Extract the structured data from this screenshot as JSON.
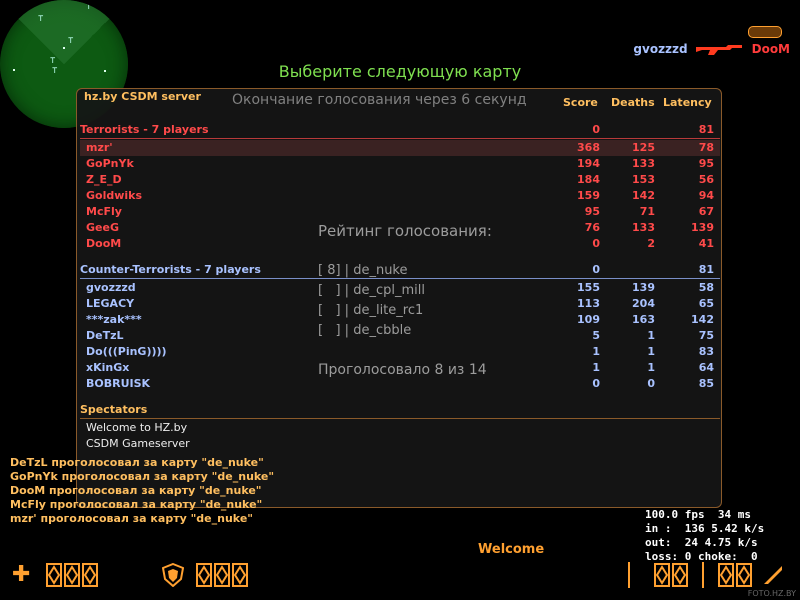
{
  "killfeed": {
    "killer": "gvozzzd",
    "weapon_icon": "rifle-icon",
    "victim": "DooM"
  },
  "vote_title": "Выберите следующую карту",
  "server_name": "hz.by CSDM server",
  "vote_end_text": "Окончание голосования через 6 секунд",
  "columns": {
    "score": "Score",
    "deaths": "Deaths",
    "latency": "Latency"
  },
  "terrorists": {
    "label": "Terrorists   -   7 players",
    "score": "0",
    "latency": "81",
    "players": [
      {
        "name": "mzr'",
        "score": "368",
        "deaths": "125",
        "latency": "78"
      },
      {
        "name": "GoPnYk",
        "score": "194",
        "deaths": "133",
        "latency": "95"
      },
      {
        "name": "Z_E_D",
        "score": "184",
        "deaths": "153",
        "latency": "56"
      },
      {
        "name": "Goldwiks",
        "score": "159",
        "deaths": "142",
        "latency": "94"
      },
      {
        "name": "McFly",
        "score": "95",
        "deaths": "71",
        "latency": "67"
      },
      {
        "name": "GeeG",
        "score": "76",
        "deaths": "133",
        "latency": "139"
      },
      {
        "name": "DooM",
        "score": "0",
        "deaths": "2",
        "latency": "41"
      }
    ]
  },
  "counter_terrorists": {
    "label": "Counter-Terrorists   -   7 players",
    "score": "0",
    "latency": "81",
    "players": [
      {
        "name": "gvozzzd",
        "score": "155",
        "deaths": "139",
        "latency": "58"
      },
      {
        "name": "LEGACY",
        "score": "113",
        "deaths": "204",
        "latency": "65"
      },
      {
        "name": "***zak***",
        "score": "109",
        "deaths": "163",
        "latency": "142"
      },
      {
        "name": "DeTzL",
        "score": "5",
        "deaths": "1",
        "latency": "75"
      },
      {
        "name": "Do(((PinG))))",
        "score": "1",
        "deaths": "1",
        "latency": "83"
      },
      {
        "name": "xKinGx",
        "score": "1",
        "deaths": "1",
        "latency": "64"
      },
      {
        "name": "BOBRUISK",
        "score": "0",
        "deaths": "0",
        "latency": "85"
      }
    ]
  },
  "vote_rating": {
    "title": "Рейтинг голосования:",
    "options": [
      {
        "votes": "[ 8]",
        "map": "de_nuke"
      },
      {
        "votes": "[   ]",
        "map": "de_cpl_mill"
      },
      {
        "votes": "[   ]",
        "map": "de_lite_rc1"
      },
      {
        "votes": "[   ]",
        "map": "de_cbble"
      }
    ],
    "voted_text": "Проголосовало 8 из 14"
  },
  "spectators_label": "Spectators",
  "motd": [
    "Welcome to HZ.by",
    "CSDM Gameserver"
  ],
  "chat": [
    "DeTzL проголосовал за карту \"de_nuke\"",
    "GoPnYk проголосовал за карту \"de_nuke\"",
    "DooM проголосовал за карту \"de_nuke\"",
    "McFly проголосовал за карту \"de_nuke\"",
    "mzr' проголосовал за карту \"de_nuke\""
  ],
  "welcome": "Welcome",
  "netgraph": [
    "100.0 fps  34 ms",
    "in :  136 5.42 k/s",
    "out:  24 4.75 k/s",
    "loss: 0 choke:  0"
  ],
  "watermark": "FOTO.HZ.BY",
  "colors": {
    "hud": "#ffa030",
    "terrorist": "#ff4a4a",
    "ct": "#a9c2ff",
    "accent": "#ffbf60"
  }
}
